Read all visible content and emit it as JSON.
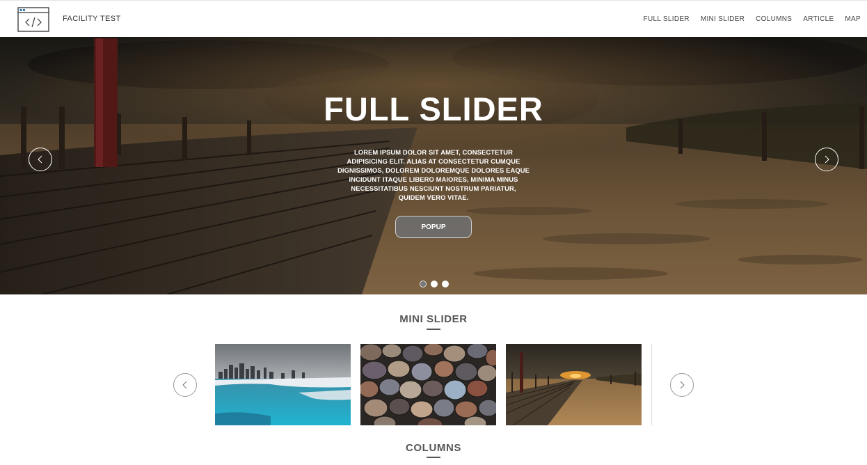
{
  "header": {
    "site_title": "FACILITY TEST",
    "nav": [
      "FULL SLIDER",
      "MINI SLIDER",
      "COLUMNS",
      "ARTICLE",
      "MAP"
    ]
  },
  "hero": {
    "title": "FULL SLIDER",
    "text": "LOREM IPSUM DOLOR SIT AMET, CONSECTETUR ADIPISICING ELIT. ALIAS AT CONSECTETUR CUMQUE DIGNISSIMOS, DOLOREM DOLOREMQUE DOLORES EAQUE INCIDUNT ITAQUE LIBERO MAIORES, MINIMA MINUS NECESSITATIBUS NESCIUNT NOSTRUM PARIATUR, QUIDEM VERO VITAE.",
    "button_label": "POPUP",
    "slide_count": 3,
    "active_slide": 1
  },
  "mini_slider": {
    "title": "MINI SLIDER",
    "thumbs": [
      "city-skyline-icy-lake",
      "pebbles",
      "beach-boardwalk-sunset"
    ]
  },
  "columns": {
    "title": "COLUMNS"
  },
  "icons": {
    "logo": "code-window-icon",
    "prev": "chevron-left-icon",
    "next": "chevron-right-icon"
  },
  "colors": {
    "accent": "#555555",
    "header_bg": "#ffffff",
    "button_bg": "#6e6e6e"
  }
}
